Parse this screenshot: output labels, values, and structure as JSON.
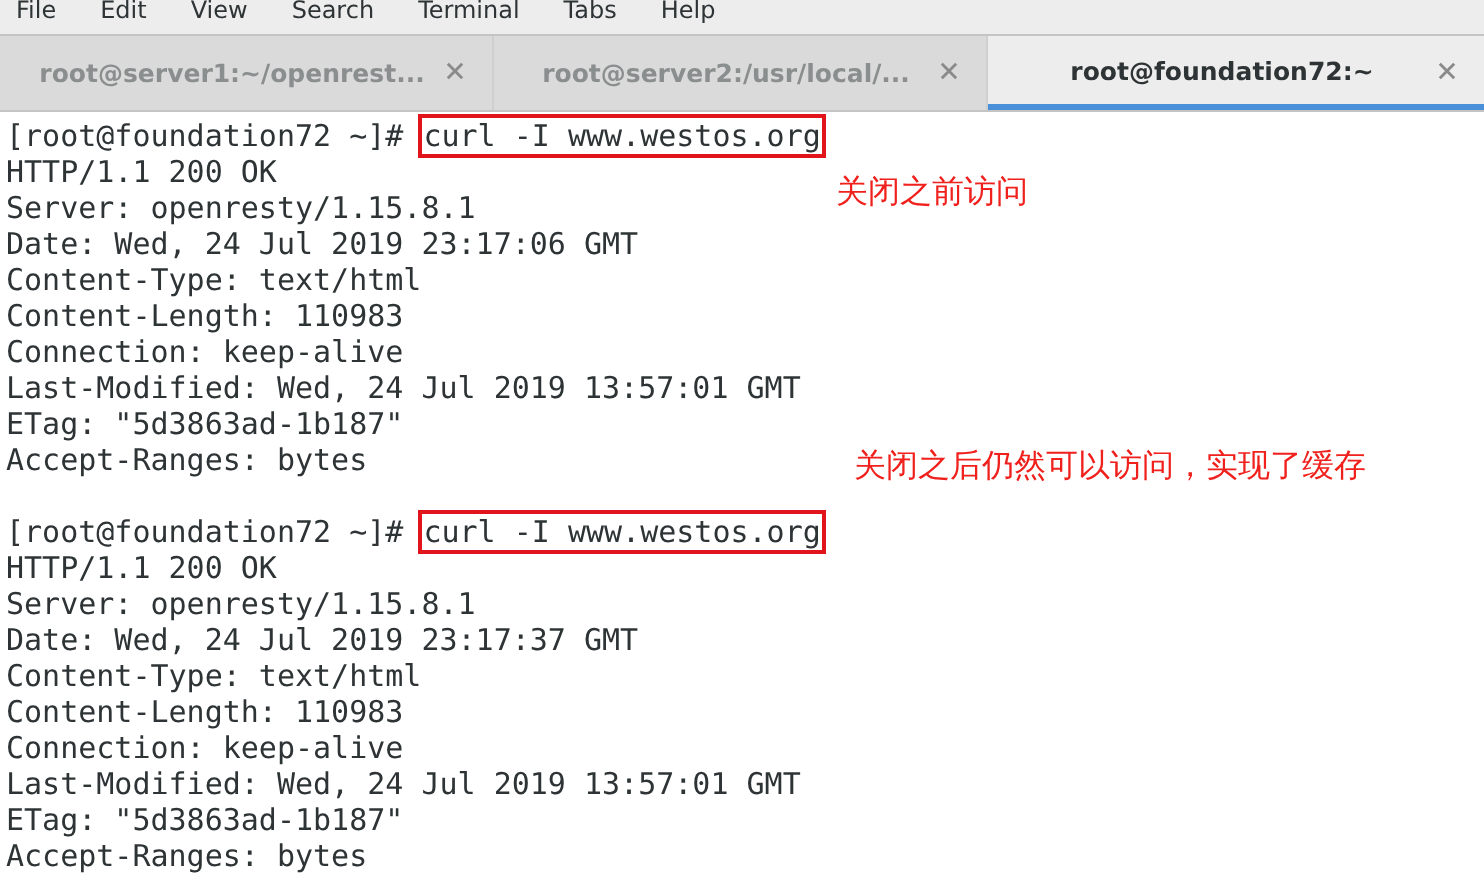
{
  "menu": [
    "File",
    "Edit",
    "View",
    "Search",
    "Terminal",
    "Tabs",
    "Help"
  ],
  "tabs": [
    {
      "label": "root@server1:~/openrest...",
      "selected": false
    },
    {
      "label": "root@server2:/usr/local/...",
      "selected": false
    },
    {
      "label": "root@foundation72:~",
      "selected": true
    }
  ],
  "terminal": {
    "lines": [
      {
        "kind": "prompt",
        "prompt": "[root@foundation72 ~]#",
        "command": "curl -I www.westos.org",
        "highlighted": true
      },
      {
        "kind": "output",
        "text": "HTTP/1.1 200 OK",
        "note": "关闭之前访问"
      },
      {
        "kind": "output",
        "text": "Server: openresty/1.15.8.1"
      },
      {
        "kind": "output",
        "text": "Date: Wed, 24 Jul 2019 23:17:06 GMT"
      },
      {
        "kind": "output",
        "text": "Content-Type: text/html"
      },
      {
        "kind": "output",
        "text": "Content-Length: 110983"
      },
      {
        "kind": "output",
        "text": "Connection: keep-alive"
      },
      {
        "kind": "output",
        "text": "Last-Modified: Wed, 24 Jul 2019 13:57:01 GMT"
      },
      {
        "kind": "output",
        "text": "ETag: \"5d3863ad-1b187\""
      },
      {
        "kind": "output",
        "text": "Accept-Ranges: bytes"
      },
      {
        "kind": "blank",
        "note": "关闭之后仍然可以访问，实现了缓存"
      },
      {
        "kind": "prompt",
        "prompt": "[root@foundation72 ~]#",
        "command": "curl -I www.westos.org",
        "highlighted": true
      },
      {
        "kind": "output",
        "text": "HTTP/1.1 200 OK"
      },
      {
        "kind": "output",
        "text": "Server: openresty/1.15.8.1"
      },
      {
        "kind": "output",
        "text": "Date: Wed, 24 Jul 2019 23:17:37 GMT"
      },
      {
        "kind": "output",
        "text": "Content-Type: text/html"
      },
      {
        "kind": "output",
        "text": "Content-Length: 110983"
      },
      {
        "kind": "output",
        "text": "Connection: keep-alive"
      },
      {
        "kind": "output",
        "text": "Last-Modified: Wed, 24 Jul 2019 13:57:01 GMT"
      },
      {
        "kind": "output",
        "text": "ETag: \"5d3863ad-1b187\""
      },
      {
        "kind": "output",
        "text": "Accept-Ranges: bytes"
      }
    ]
  }
}
